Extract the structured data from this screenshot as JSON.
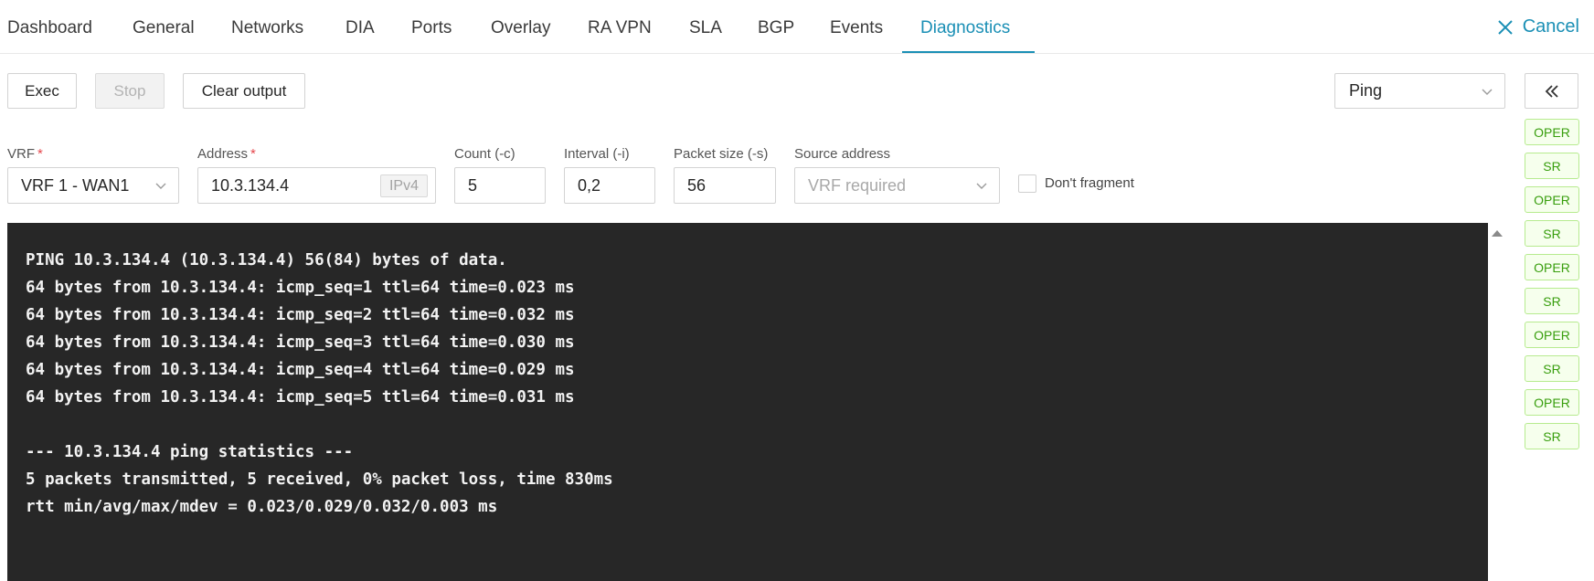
{
  "tabs": [
    {
      "label": "Dashboard"
    },
    {
      "label": "General"
    },
    {
      "label": "Networks"
    },
    {
      "label": "DIA"
    },
    {
      "label": "Ports"
    },
    {
      "label": "Overlay"
    },
    {
      "label": "RA VPN"
    },
    {
      "label": "SLA"
    },
    {
      "label": "BGP"
    },
    {
      "label": "Events"
    },
    {
      "label": "Diagnostics"
    }
  ],
  "active_tab": "Diagnostics",
  "cancel_label": "Cancel",
  "toolbar": {
    "exec_label": "Exec",
    "stop_label": "Stop",
    "clear_label": "Clear output",
    "mode_value": "Ping"
  },
  "form": {
    "vrf_label": "VRF",
    "vrf_value": "VRF 1 - WAN1",
    "address_label": "Address",
    "address_value": "10.3.134.4",
    "address_badge": "IPv4",
    "count_label": "Count (-c)",
    "count_value": "5",
    "interval_label": "Interval (-i)",
    "interval_value": "0,2",
    "packet_size_label": "Packet size (-s)",
    "packet_size_value": "56",
    "source_label": "Source address",
    "source_placeholder": "VRF required",
    "dont_fragment_label": "Don't fragment",
    "required_mark": "*"
  },
  "output": {
    "lines": [
      "PING 10.3.134.4 (10.3.134.4) 56(84) bytes of data.",
      "64 bytes from 10.3.134.4: icmp_seq=1 ttl=64 time=0.023 ms",
      "64 bytes from 10.3.134.4: icmp_seq=2 ttl=64 time=0.032 ms",
      "64 bytes from 10.3.134.4: icmp_seq=3 ttl=64 time=0.030 ms",
      "64 bytes from 10.3.134.4: icmp_seq=4 ttl=64 time=0.029 ms",
      "64 bytes from 10.3.134.4: icmp_seq=5 ttl=64 time=0.031 ms",
      "",
      "--- 10.3.134.4 ping statistics ---",
      "5 packets transmitted, 5 received, 0% packet loss, time 830ms",
      "rtt min/avg/max/mdev = 0.023/0.029/0.032/0.003 ms"
    ]
  },
  "side_badges": [
    "OPER",
    "SR",
    "OPER",
    "SR",
    "OPER",
    "SR",
    "OPER",
    "SR",
    "OPER",
    "SR"
  ],
  "colors": {
    "accent": "#1a8fb5",
    "terminal_bg": "#272727",
    "badge_green": "#389e0d",
    "required": "#e5484d"
  },
  "icons": {
    "cancel": "close-icon",
    "collapse": "double-chevron-left-icon",
    "dropdown": "chevron-down-icon",
    "scroll": "scroll-up-arrow-icon"
  }
}
